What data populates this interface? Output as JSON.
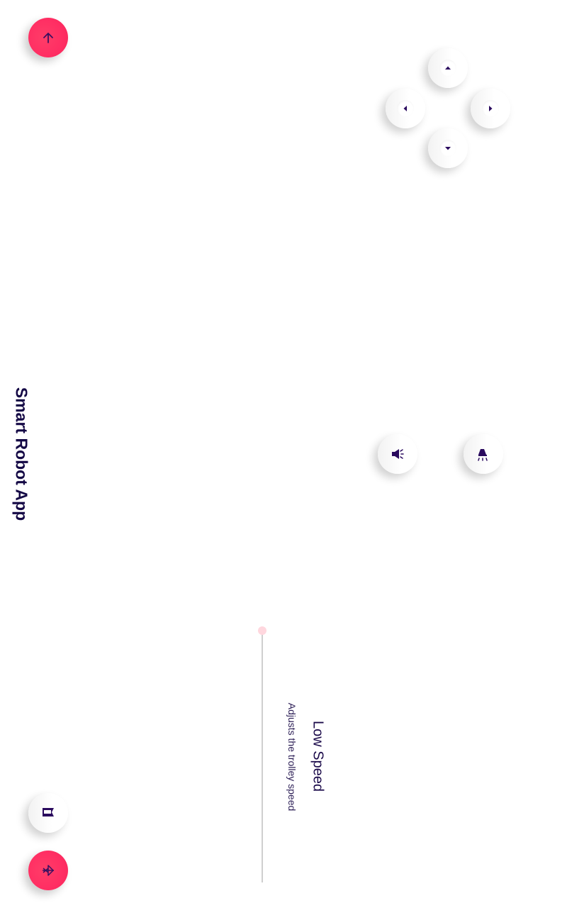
{
  "app": {
    "title": "Smart Robot App"
  },
  "speed": {
    "title": "Low Speed",
    "description": "Adjusts the trolley speed",
    "value_percent": 0
  },
  "colors": {
    "accent": "#ff2e63",
    "ink": "#1b0a4a",
    "surface": "#ffffff"
  },
  "icons": {
    "top_action": "arrow-up-icon",
    "bottom_action": "bluetooth-disabled-icon",
    "flag": "flag-icon",
    "horn": "megaphone-icon",
    "light": "lamp-icon",
    "dpad": [
      "caret-up-icon",
      "caret-left-icon",
      "caret-right-icon",
      "caret-down-icon"
    ]
  }
}
